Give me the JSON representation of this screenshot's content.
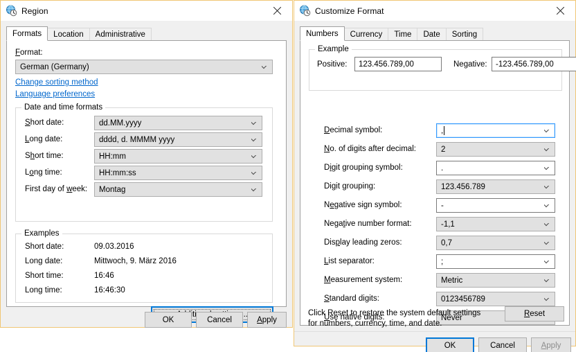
{
  "region_window": {
    "title": "Region",
    "icon": "region-globe-clock-icon",
    "close_label": "✕",
    "tabs": [
      {
        "label": "Formats",
        "active": true
      },
      {
        "label": "Location",
        "active": false
      },
      {
        "label": "Administrative",
        "active": false
      }
    ],
    "format": {
      "label": "Format:",
      "label_accel": "F",
      "value": "German (Germany)"
    },
    "links": [
      "Change sorting method",
      "Language preferences"
    ],
    "datetime_group": {
      "title": "Date and time formats",
      "rows": [
        {
          "label": "Short date:",
          "accel": "S",
          "value": "dd.MM.yyyy"
        },
        {
          "label": "Long date:",
          "accel": "L",
          "value": "dddd, d. MMMM yyyy"
        },
        {
          "label": "Short time:",
          "accel": "h",
          "value": "HH:mm"
        },
        {
          "label": "Long time:",
          "accel": "o",
          "value": "HH:mm:ss"
        },
        {
          "label": "First day of week:",
          "accel": "w",
          "value": "Montag"
        }
      ]
    },
    "examples_group": {
      "title": "Examples",
      "rows": [
        {
          "label": "Short date:",
          "value": "09.03.2016"
        },
        {
          "label": "Long date:",
          "value": "Mittwoch, 9. März 2016"
        },
        {
          "label": "Short time:",
          "value": "16:46"
        },
        {
          "label": "Long time:",
          "value": "16:46:30"
        }
      ]
    },
    "additional_settings_button": "Additional settings...",
    "buttons": {
      "ok": "OK",
      "cancel": "Cancel",
      "apply": "Apply"
    }
  },
  "customize_window": {
    "title": "Customize Format",
    "icon": "region-globe-clock-icon",
    "close_label": "✕",
    "tabs": [
      {
        "label": "Numbers",
        "active": true
      },
      {
        "label": "Currency",
        "active": false
      },
      {
        "label": "Time",
        "active": false
      },
      {
        "label": "Date",
        "active": false
      },
      {
        "label": "Sorting",
        "active": false
      }
    ],
    "example_group": {
      "title": "Example",
      "positive_label": "Positive:",
      "positive_value": "123.456.789,00",
      "negative_label": "Negative:",
      "negative_value": "-123.456.789,00"
    },
    "settings": [
      {
        "label": "Decimal symbol:",
        "accel": "D",
        "value": ",",
        "focused": true,
        "editable": true
      },
      {
        "label": "No. of digits after decimal:",
        "accel": "N",
        "value": "2",
        "focused": false,
        "editable": false
      },
      {
        "label": "Digit grouping symbol:",
        "accel": "i",
        "value": ".",
        "focused": false,
        "editable": true
      },
      {
        "label": "Digit grouping:",
        "accel": "g",
        "value": "123.456.789",
        "focused": false,
        "editable": false
      },
      {
        "label": "Negative sign symbol:",
        "accel": "e",
        "value": "-",
        "focused": false,
        "editable": true
      },
      {
        "label": "Negative number format:",
        "accel": "t",
        "value": "-1,1",
        "focused": false,
        "editable": false
      },
      {
        "label": "Display leading zeros:",
        "accel": "p",
        "value": "0,7",
        "focused": false,
        "editable": false
      },
      {
        "label": "List separator:",
        "accel": "L",
        "value": ";",
        "focused": false,
        "editable": true
      },
      {
        "label": "Measurement system:",
        "accel": "M",
        "value": "Metric",
        "focused": false,
        "editable": false
      },
      {
        "label": "Standard digits:",
        "accel": "S",
        "value": "0123456789",
        "focused": false,
        "editable": false
      },
      {
        "label": "Use native digits:",
        "accel": "U",
        "value": "Never",
        "focused": false,
        "editable": false
      }
    ],
    "reset_help": "Click Reset to restore the system default settings for numbers, currency, time, and date.",
    "reset_button": "Reset",
    "reset_accel": "R",
    "buttons": {
      "ok": "OK",
      "cancel": "Cancel",
      "apply": "Apply"
    }
  },
  "colors": {
    "window_border": "#f0c674",
    "focus_blue": "#0078d7",
    "link_blue": "#0066cc",
    "control_gray": "#e1e1e1",
    "disabled_text": "#8d8d8d"
  }
}
